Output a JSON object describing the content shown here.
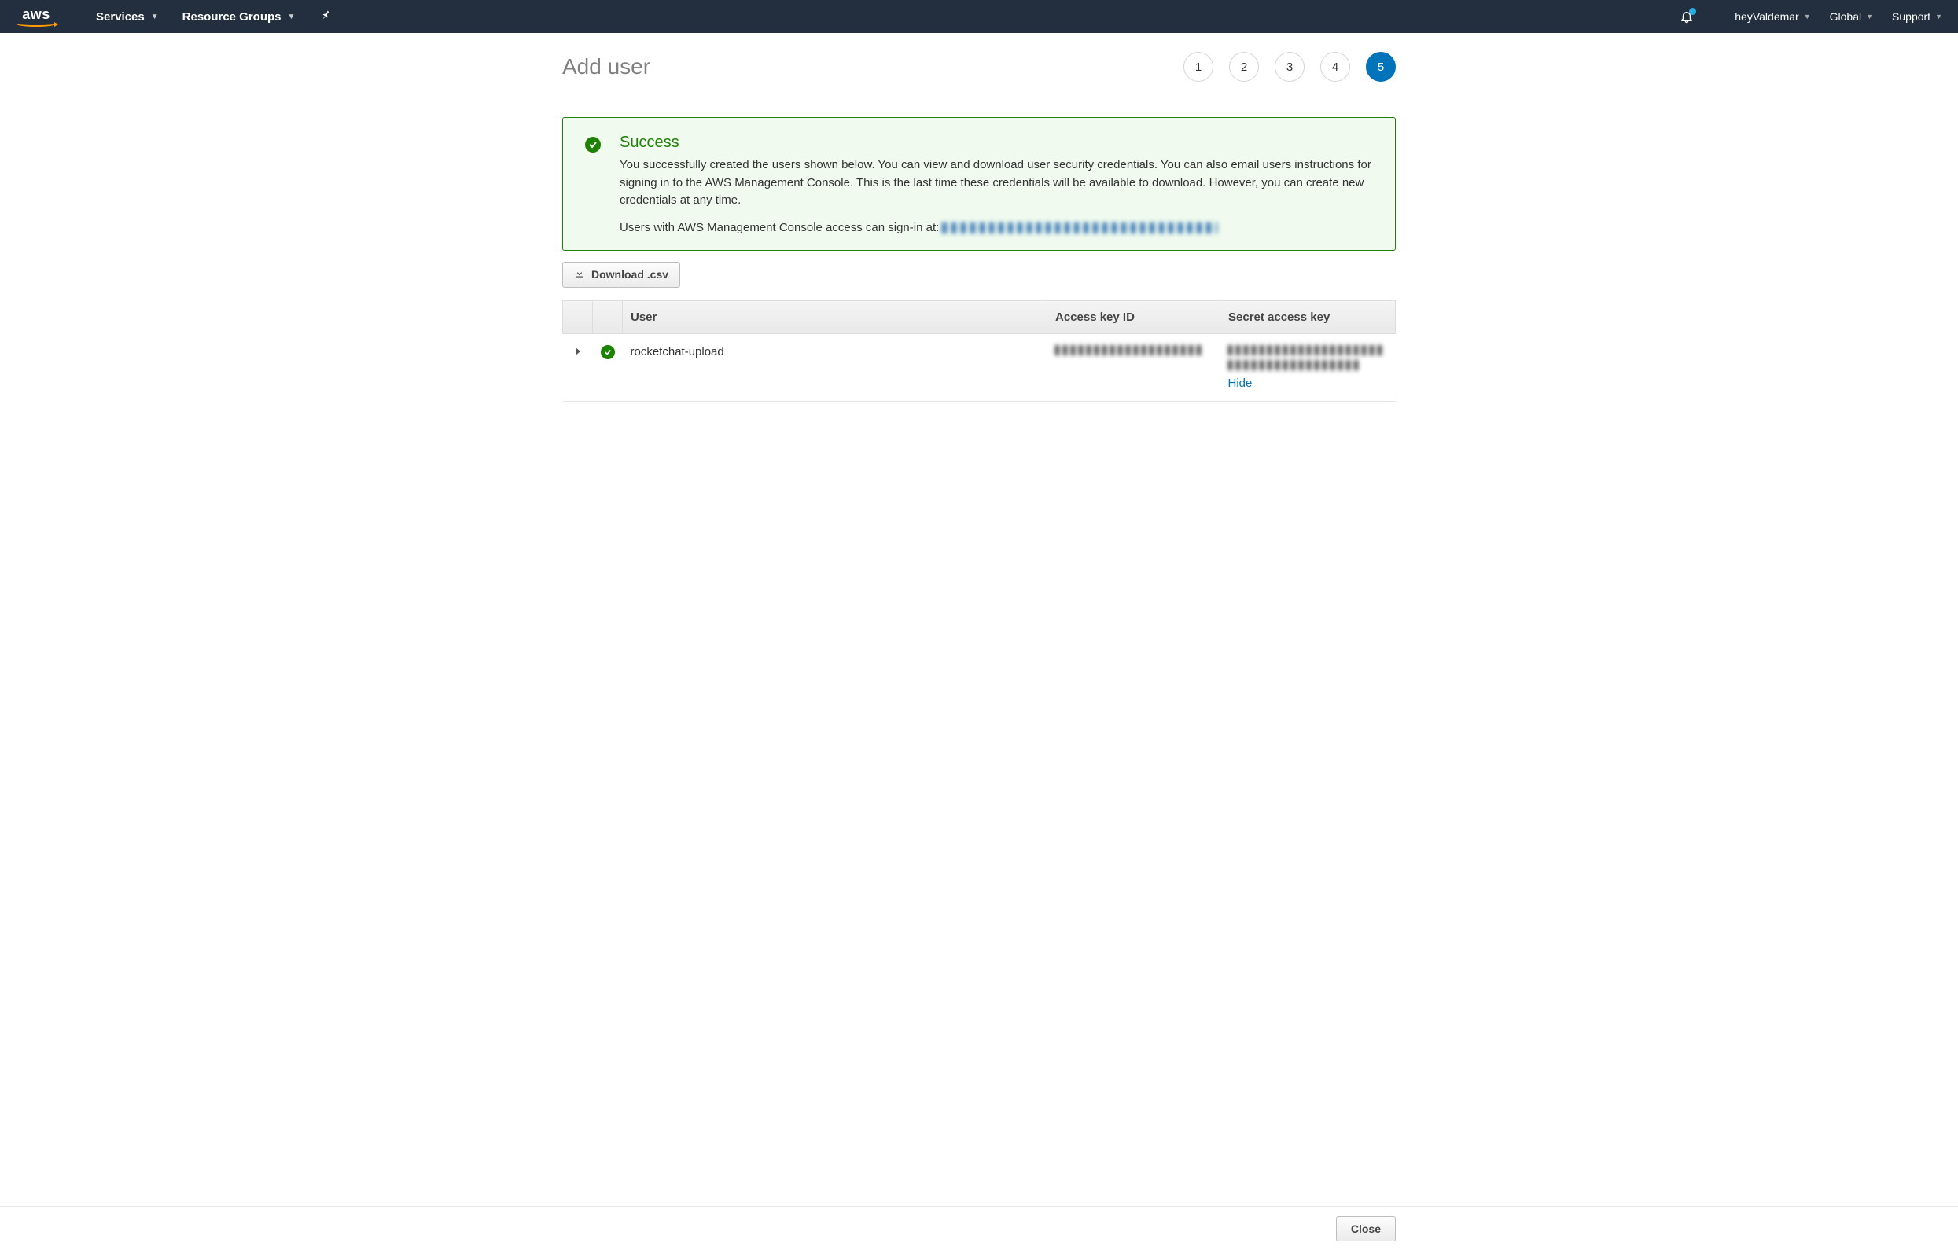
{
  "nav": {
    "logo_text": "aws",
    "services": "Services",
    "resource_groups": "Resource Groups",
    "user": "heyValdemar",
    "region": "Global",
    "support": "Support"
  },
  "page": {
    "title": "Add user"
  },
  "wizard": {
    "steps": [
      "1",
      "2",
      "3",
      "4",
      "5"
    ],
    "active_index": 4
  },
  "alert": {
    "title": "Success",
    "text": "You successfully created the users shown below. You can view and download user security credentials. You can also email users instructions for signing in to the AWS Management Console. This is the last time these credentials will be available to download. However, you can create new credentials at any time.",
    "signin_prefix": "Users with AWS Management Console access can sign-in at:"
  },
  "buttons": {
    "download_csv": "Download .csv",
    "close": "Close"
  },
  "table": {
    "headers": {
      "user": "User",
      "access_key": "Access key ID",
      "secret_key": "Secret access key"
    },
    "rows": [
      {
        "user": "rocketchat-upload",
        "hide_label": "Hide"
      }
    ]
  }
}
